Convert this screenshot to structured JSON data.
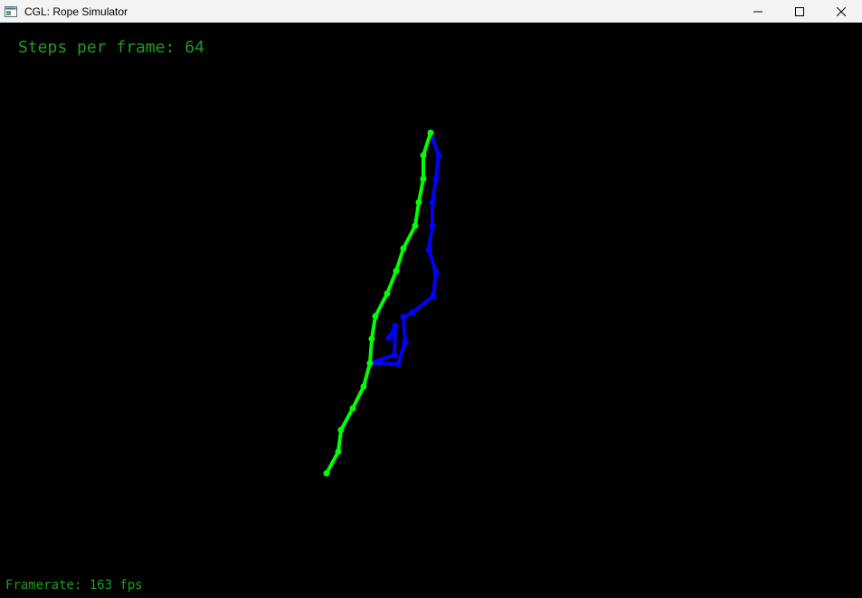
{
  "window": {
    "title": "CGL: Rope Simulator",
    "icon": "app-window-icon",
    "controls": {
      "minimize_icon": "minimize-icon",
      "maximize_icon": "maximize-icon",
      "close_icon": "close-icon"
    }
  },
  "hud": {
    "steps_per_frame": "Steps per frame: 64",
    "framerate": "Framerate: 163 fps"
  },
  "colors": {
    "titlebar_bg": "#f3f3f3",
    "canvas_bg": "#000000",
    "hud_text": "#1e9e1e",
    "rope_green": "#00ff00",
    "rope_blue": "#0000ff"
  }
}
